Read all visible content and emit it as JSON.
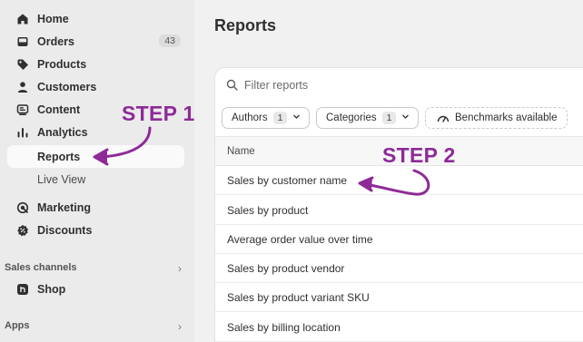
{
  "sidebar": {
    "items": [
      {
        "label": "Home",
        "icon": "home-icon"
      },
      {
        "label": "Orders",
        "icon": "inbox-icon",
        "badge": "43"
      },
      {
        "label": "Products",
        "icon": "tag-icon"
      },
      {
        "label": "Customers",
        "icon": "person-icon"
      },
      {
        "label": "Content",
        "icon": "content-icon"
      },
      {
        "label": "Analytics",
        "icon": "bar-chart-icon"
      }
    ],
    "analytics_sub": [
      {
        "label": "Reports",
        "active": true
      },
      {
        "label": "Live View",
        "active": false
      }
    ],
    "items2": [
      {
        "label": "Marketing",
        "icon": "target-icon"
      },
      {
        "label": "Discounts",
        "icon": "discount-icon"
      }
    ],
    "sales_channels": {
      "label": "Sales channels",
      "items": [
        {
          "label": "Shop",
          "icon": "shop-icon"
        }
      ]
    },
    "apps": {
      "label": "Apps"
    }
  },
  "main": {
    "title": "Reports",
    "search": {
      "placeholder": "Filter reports",
      "value": ""
    },
    "filters": {
      "authors": {
        "label": "Authors",
        "count": "1"
      },
      "categories": {
        "label": "Categories",
        "count": "1"
      },
      "benchmarks": {
        "label": "Benchmarks available"
      }
    },
    "table": {
      "header": "Name",
      "rows": [
        "Sales by customer name",
        "Sales by product",
        "Average order value over time",
        "Sales by product vendor",
        "Sales by product variant SKU",
        "Sales by billing location"
      ]
    }
  },
  "annotations": {
    "step1": "STEP 1",
    "step2": "STEP 2",
    "color": "#8e2a98"
  }
}
